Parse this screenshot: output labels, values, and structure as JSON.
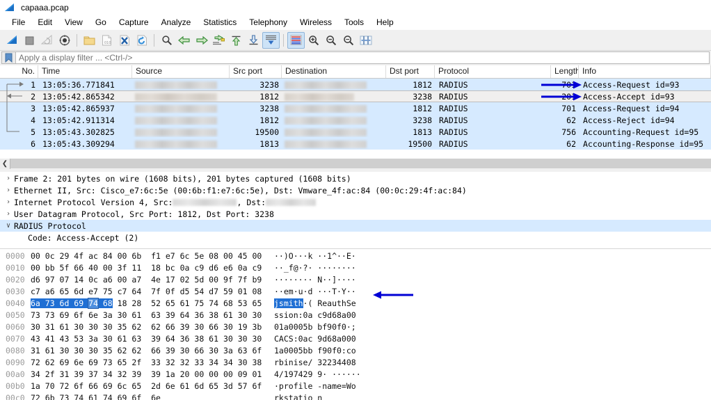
{
  "window": {
    "title": "capaaa.pcap",
    "app_icon": "wireshark-fin-icon"
  },
  "menubar": {
    "items": [
      "File",
      "Edit",
      "View",
      "Go",
      "Capture",
      "Analyze",
      "Statistics",
      "Telephony",
      "Wireless",
      "Tools",
      "Help"
    ]
  },
  "toolbar": {
    "buttons": [
      {
        "name": "start-capture-icon",
        "label": "Start"
      },
      {
        "name": "stop-capture-icon",
        "label": "Stop"
      },
      {
        "name": "restart-capture-icon",
        "label": "Restart"
      },
      {
        "name": "capture-options-icon",
        "label": "Capture Options"
      },
      {
        "name": "open-file-icon",
        "label": "Open"
      },
      {
        "name": "save-file-icon",
        "label": "Save"
      },
      {
        "name": "close-file-icon",
        "label": "Close"
      },
      {
        "name": "reload-file-icon",
        "label": "Reload"
      },
      {
        "name": "find-packet-icon",
        "label": "Find Packet"
      },
      {
        "name": "go-back-icon",
        "label": "Go Back"
      },
      {
        "name": "go-forward-icon",
        "label": "Go Forward"
      },
      {
        "name": "go-to-packet-icon",
        "label": "Go to Packet"
      },
      {
        "name": "go-to-first-icon",
        "label": "Go to First"
      },
      {
        "name": "go-to-last-icon",
        "label": "Go to Last"
      },
      {
        "name": "auto-scroll-icon",
        "label": "Auto Scroll"
      },
      {
        "name": "colorize-icon",
        "label": "Colorize"
      },
      {
        "name": "zoom-in-icon",
        "label": "Zoom In"
      },
      {
        "name": "zoom-out-icon",
        "label": "Zoom Out"
      },
      {
        "name": "zoom-reset-icon",
        "label": "Normal Size"
      },
      {
        "name": "resize-columns-icon",
        "label": "Resize Columns"
      }
    ]
  },
  "filter": {
    "placeholder": "Apply a display filter ... <Ctrl-/>",
    "value": "",
    "bookmark_icon": "filter-bookmark-icon"
  },
  "packet_list": {
    "columns": [
      "No.",
      "Time",
      "Source",
      "Src port",
      "Destination",
      "Dst port",
      "Protocol",
      "Length",
      "Info"
    ],
    "rows": [
      {
        "no": "1",
        "time": "13:05:36.771841",
        "source": "",
        "src_port": "3238",
        "destination": "",
        "dst_port": "1812",
        "protocol": "RADIUS",
        "length": "701",
        "info": "Access-Request id=93",
        "state": "blue",
        "flow": "request-start"
      },
      {
        "no": "2",
        "time": "13:05:42.865342",
        "source": "",
        "src_port": "1812",
        "destination": "",
        "dst_port": "3238",
        "protocol": "RADIUS",
        "length": "201",
        "info": "Access-Accept id=93",
        "state": "grey",
        "flow": "response"
      },
      {
        "no": "3",
        "time": "13:05:42.865937",
        "source": "",
        "src_port": "3238",
        "destination": "",
        "dst_port": "1812",
        "protocol": "RADIUS",
        "length": "701",
        "info": "Access-Request id=94",
        "state": "blue",
        "flow": "none"
      },
      {
        "no": "4",
        "time": "13:05:42.911314",
        "source": "",
        "src_port": "1812",
        "destination": "",
        "dst_port": "3238",
        "protocol": "RADIUS",
        "length": "62",
        "info": "Access-Reject id=94",
        "state": "blue",
        "flow": "end"
      },
      {
        "no": "5",
        "time": "13:05:43.302825",
        "source": "",
        "src_port": "19500",
        "destination": "",
        "dst_port": "1813",
        "protocol": "RADIUS",
        "length": "756",
        "info": "Accounting-Request id=95",
        "state": "blue",
        "flow": "none"
      },
      {
        "no": "6",
        "time": "13:05:43.309294",
        "source": "",
        "src_port": "1813",
        "destination": "",
        "dst_port": "19500",
        "protocol": "RADIUS",
        "length": "62",
        "info": "Accounting-Response id=95",
        "state": "blue",
        "flow": "none"
      }
    ],
    "selected_row": "2"
  },
  "detail_pane": {
    "rows": [
      {
        "twisty": "›",
        "text": "Frame 2: 201 bytes on wire (1608 bits), 201 bytes captured (1608 bits)",
        "selected": false,
        "indent": false,
        "redacted": false
      },
      {
        "twisty": "›",
        "text": "Ethernet II, Src: Cisco_e7:6c:5e (00:6b:f1:e7:6c:5e), Dst: Vmware_4f:ac:84 (00:0c:29:4f:ac:84)",
        "selected": false,
        "indent": false,
        "redacted": false
      },
      {
        "twisty": "›",
        "text": "Internet Protocol Version 4, Src: ",
        "text2": ", Dst: ",
        "selected": false,
        "indent": false,
        "redacted": true
      },
      {
        "twisty": "›",
        "text": "User Datagram Protocol, Src Port: 1812, Dst Port: 3238",
        "selected": false,
        "indent": false,
        "redacted": false
      },
      {
        "twisty": "∨",
        "text": "RADIUS Protocol",
        "selected": true,
        "indent": false,
        "redacted": false
      },
      {
        "twisty": "",
        "text": "Code: Access-Accept (2)",
        "selected": false,
        "indent": true,
        "redacted": false
      }
    ]
  },
  "hex_pane": {
    "rows": [
      {
        "offset": "0000",
        "bytes": "00 0c 29 4f ac 84 00 6b  f1 e7 6c 5e 08 00 45 00",
        "ascii": "··)O···k ··1^··E·"
      },
      {
        "offset": "0010",
        "bytes": "00 bb 5f 66 40 00 3f 11  18 bc 0a c9 d6 e6 0a c9",
        "ascii": "··_f@·?· ········"
      },
      {
        "offset": "0020",
        "bytes": "d6 97 07 14 0c a6 00 a7  4e 17 02 5d 00 9f 7f b9",
        "ascii": "········ N··]····"
      },
      {
        "offset": "0030",
        "bytes": "c7 a6 65 6d e7 75 c7 64  7f 0f d5 54 d7 59 01 08",
        "ascii": "··em·u·d ···T·Y··"
      },
      {
        "offset": "0040",
        "bytes": "6a 73 6d 69 74 68 18 28  52 65 61 75 74 68 53 65",
        "ascii": "jsmith·( ReauthSe",
        "highlight": {
          "byte_start": 0,
          "byte_end": 6,
          "cursor_byte": 4,
          "ascii_start": 0,
          "ascii_end": 6
        }
      },
      {
        "offset": "0050",
        "bytes": "73 73 69 6f 6e 3a 30 61  63 39 64 36 38 61 30 30",
        "ascii": "ssion:0a c9d68a00"
      },
      {
        "offset": "0060",
        "bytes": "30 31 61 30 30 30 35 62  62 66 39 30 66 30 19 3b",
        "ascii": "01a0005b bf90f0·;"
      },
      {
        "offset": "0070",
        "bytes": "43 41 43 53 3a 30 61 63  39 64 36 38 61 30 30 30",
        "ascii": "CACS:0ac 9d68a000"
      },
      {
        "offset": "0080",
        "bytes": "31 61 30 30 30 35 62 62  66 39 30 66 30 3a 63 6f",
        "ascii": "1a0005bb f90f0:co"
      },
      {
        "offset": "0090",
        "bytes": "72 62 69 6e 69 73 65 2f  33 32 32 33 34 34 30 38",
        "ascii": "rbinise/ 32234408"
      },
      {
        "offset": "00a0",
        "bytes": "34 2f 31 39 37 34 32 39  39 1a 20 00 00 00 09 01",
        "ascii": "4/197429 9· ······"
      },
      {
        "offset": "00b0",
        "bytes": "1a 70 72 6f 66 69 6c 65  2d 6e 61 6d 65 3d 57 6f",
        "ascii": "·profile -name=Wo"
      },
      {
        "offset": "00c0",
        "bytes": "72 6b 73 74 61 74 69 6f  6e",
        "ascii": "rkstatio n"
      }
    ]
  },
  "annotations": {
    "arrow_color": "#0000d5",
    "arrows": [
      {
        "name": "annotation-arrow-length-701",
        "direction": "right",
        "target": "packet-row-1-length"
      },
      {
        "name": "annotation-arrow-length-201",
        "direction": "right",
        "target": "packet-row-2-length"
      },
      {
        "name": "annotation-arrow-username",
        "direction": "left",
        "target": "hex-ascii-jsmith"
      }
    ]
  },
  "colors": {
    "selection_blue": "#d6eaff",
    "selection_grey": "#f0efee",
    "hex_highlight": "#1f6fd4",
    "annotation": "#0000d5",
    "toolbar_bg": "#f0f0f0"
  }
}
